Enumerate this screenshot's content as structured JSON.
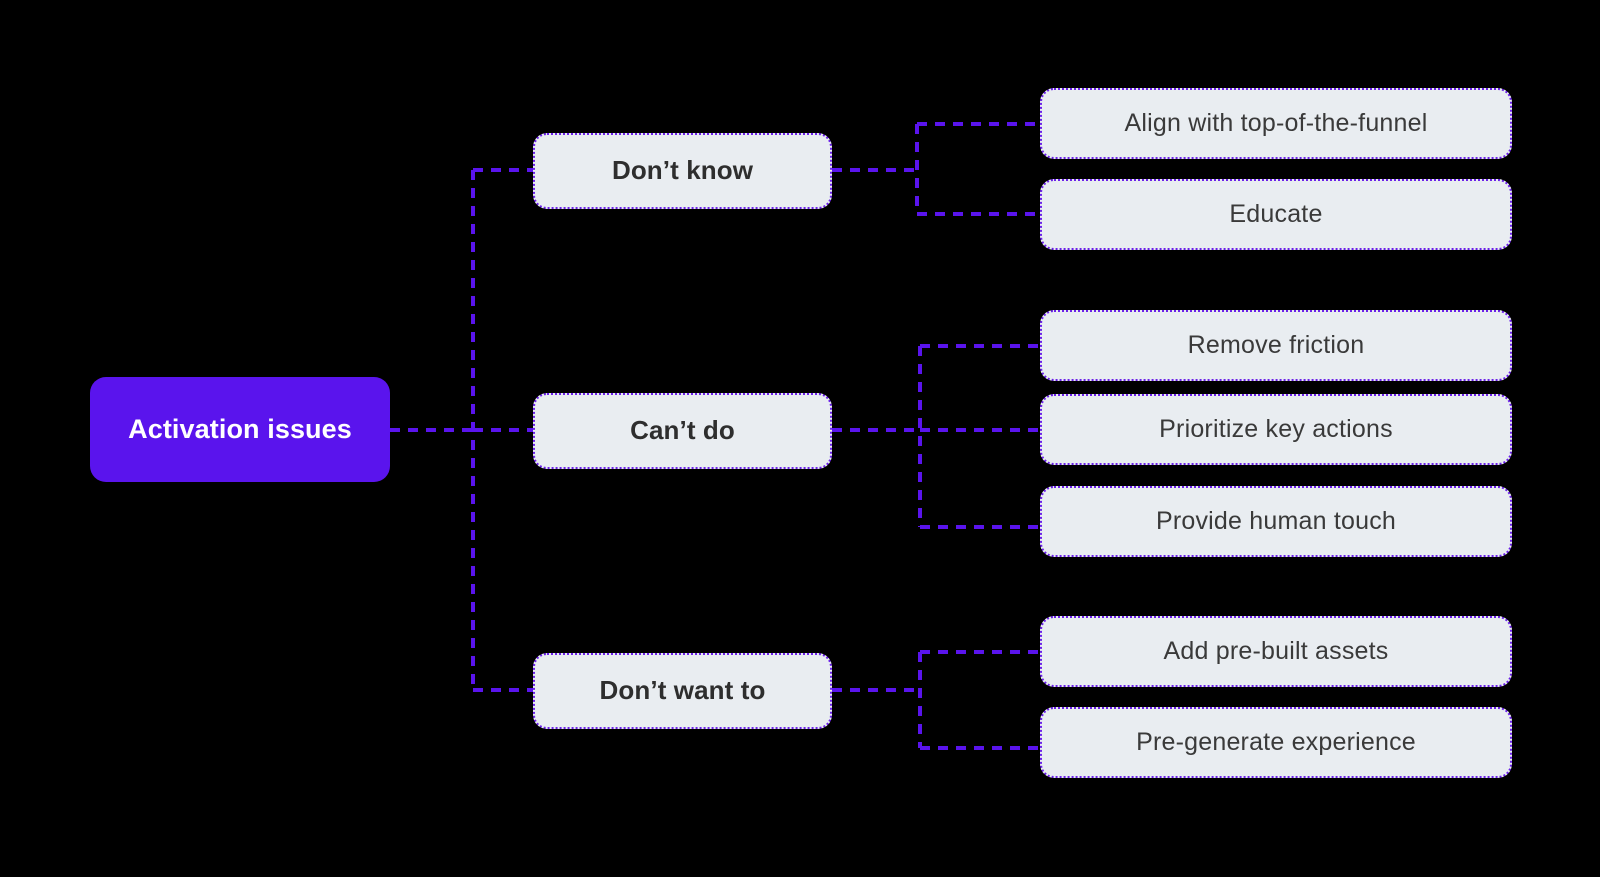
{
  "diagram": {
    "title": "Activation issues",
    "background_color": "#000000",
    "accent_color": "#5A14ED",
    "card_fill_color": "#E9EDF1",
    "card_border_color": "#6B21E8",
    "root": {
      "label": "Activation issues"
    },
    "branches": [
      {
        "label": "Don’t know",
        "leaves": [
          {
            "label": "Align with top-of-the-funnel"
          },
          {
            "label": "Educate"
          }
        ]
      },
      {
        "label": "Can’t do",
        "leaves": [
          {
            "label": "Remove friction"
          },
          {
            "label": "Prioritize key actions"
          },
          {
            "label": "Provide human touch"
          }
        ]
      },
      {
        "label": "Don’t want to",
        "leaves": [
          {
            "label": "Add pre-built assets"
          },
          {
            "label": "Pre-generate experience"
          }
        ]
      }
    ]
  }
}
